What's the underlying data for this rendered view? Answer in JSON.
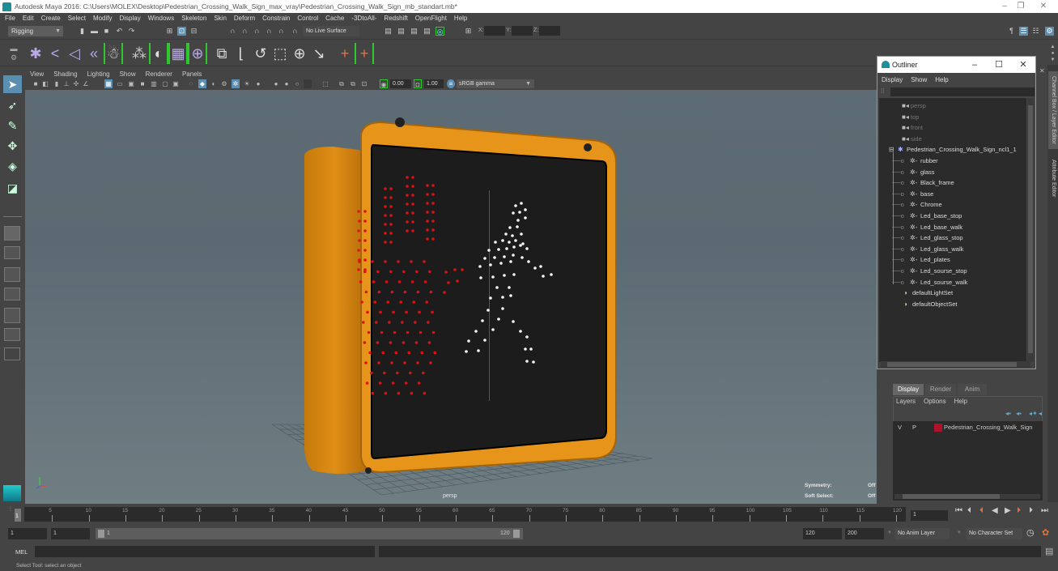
{
  "window": {
    "title": "Autodesk Maya 2016: C:\\Users\\MOLEX\\Desktop\\Pedestrian_Crossing_Walk_Sign_max_vray\\Pedestrian_Crossing_Walk_Sign_mb_standart.mb*",
    "controls": {
      "minimize": "–",
      "restore": "❐",
      "close": "✕"
    }
  },
  "menubar": [
    "File",
    "Edit",
    "Create",
    "Select",
    "Modify",
    "Display",
    "Windows",
    "Skeleton",
    "Skin",
    "Deform",
    "Constrain",
    "Control",
    "Cache",
    "-3DtoAll-",
    "Redshift",
    "OpenFlight",
    "Help"
  ],
  "statusline": {
    "menuset": "Rigging",
    "live_surface": "No Live Surface",
    "x_label": "X:",
    "y_label": "Y:",
    "z_label": "Z:",
    "x_value": "",
    "y_value": "",
    "z_value": ""
  },
  "shelf": {
    "icons": [
      "joint-tool-icon",
      "ik-handle-icon",
      "ik-spline-icon",
      "insert-joint-icon",
      "humanik-icon",
      "bind-skin-icon",
      "smooth-bind-icon",
      "lattice-icon",
      "cluster-icon",
      "parent-constraint-icon",
      "point-constraint-icon",
      "orient-constraint-icon",
      "scale-constraint-icon",
      "aim-constraint-icon",
      "pole-vector-icon",
      "locator-icon",
      "bracketed-locator-icon"
    ]
  },
  "toolbox": {
    "tools": [
      "select-tool-icon",
      "lasso-tool-icon",
      "paint-select-icon",
      "move-tool-icon",
      "rotate-tool-icon",
      "scale-tool-icon"
    ],
    "layouts": [
      "single-pane-layout-icon",
      "four-pane-layout-icon",
      "two-pane-side-layout-icon",
      "two-pane-stacked-layout-icon",
      "outliner-persp-layout-icon",
      "persp-graph-layout-icon",
      "empty-layout-icon"
    ]
  },
  "viewport": {
    "menu": [
      "View",
      "Shading",
      "Lighting",
      "Show",
      "Renderer",
      "Panels"
    ],
    "exposure": "0.00",
    "gamma": "1.00",
    "color_space": "sRGB gamma",
    "camera_label": "persp",
    "hud": [
      {
        "label": "Symmetry:",
        "value": "Off"
      },
      {
        "label": "Soft Select:",
        "value": "Off"
      }
    ]
  },
  "outliner": {
    "title": "Outliner",
    "menu": [
      "Display",
      "Show",
      "Help"
    ],
    "search_value": "",
    "cameras": [
      "persp",
      "top",
      "front",
      "side"
    ],
    "root": "Pedestrian_Crossing_Walk_Sign_ncl1_1",
    "children": [
      "rubber",
      "glass",
      "Black_frame",
      "base",
      "Chrome",
      "Led_base_stop",
      "Led_base_walk",
      "Led_glass_stop",
      "Led_glass_walk",
      "Led_plates",
      "Led_sourse_stop",
      "Led_sourse_walk"
    ],
    "sets": [
      "defaultLightSet",
      "defaultObjectSet"
    ]
  },
  "right_tabs": [
    "Channel Box / Layer Editor",
    "Attribute Editor"
  ],
  "layer_editor": {
    "tabs": [
      "Display",
      "Render",
      "Anim"
    ],
    "active_tab": "Display",
    "menu": [
      "Layers",
      "Options",
      "Help"
    ],
    "layers": [
      {
        "v": "V",
        "p": "P",
        "color": "#b0102a",
        "name": "Pedestrian_Crossing_Walk_Sign"
      }
    ]
  },
  "timeline": {
    "ticks": [
      5,
      10,
      15,
      20,
      25,
      30,
      35,
      40,
      45,
      50,
      55,
      60,
      65,
      70,
      75,
      80,
      85,
      90,
      95,
      100,
      105,
      110,
      115,
      120
    ],
    "start_label": "1",
    "min": 1,
    "max": 120,
    "current_frame": "1"
  },
  "range": {
    "start": "1",
    "anim_start": "1",
    "slider_start": "1",
    "slider_end": "120",
    "anim_end": "120",
    "end": "200",
    "anim_layer": "No Anim Layer",
    "character_set": "No Character Set"
  },
  "cmdline": {
    "label": "MEL",
    "value": ""
  },
  "helpline": "Select Tool: select an object"
}
